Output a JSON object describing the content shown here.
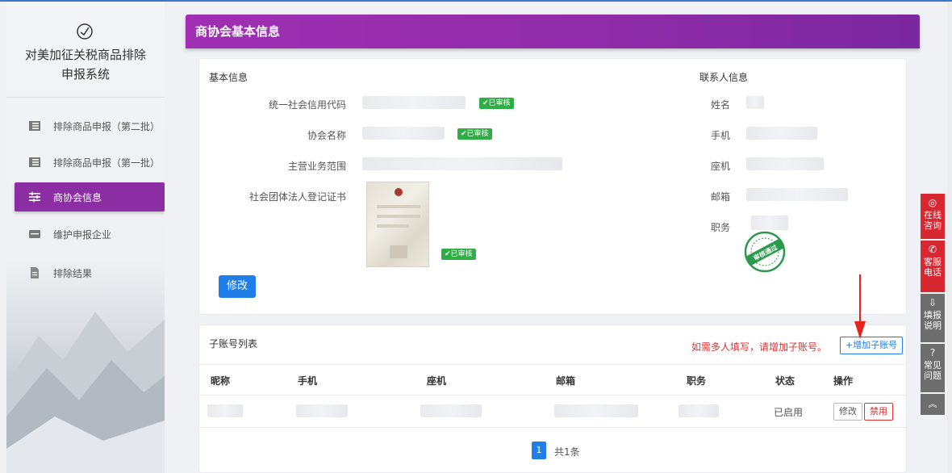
{
  "sidebar": {
    "title_line1": "对美加征关税商品排除",
    "title_line2": "申报系统",
    "items": [
      {
        "label": "排除商品申报（第二批）",
        "icon": "list-icon"
      },
      {
        "label": "排除商品申报（第一批）",
        "icon": "list-icon"
      },
      {
        "label": "商协会信息",
        "icon": "sliders-icon",
        "active": true
      },
      {
        "label": "维护申报企业",
        "icon": "inbox-icon"
      },
      {
        "label": "排除结果",
        "icon": "document-icon"
      }
    ]
  },
  "header": {
    "title": "商协会基本信息"
  },
  "basic": {
    "title": "基本信息",
    "credit_code_label": "统一社会信用代码",
    "assoc_name_label": "协会名称",
    "business_scope_label": "主营业务范围",
    "certificate_label": "社会团体法人登记证书",
    "verified_badge": "✔已审核",
    "edit_button": "修改"
  },
  "contact": {
    "title": "联系人信息",
    "name_label": "姓名",
    "mobile_label": "手机",
    "landline_label": "座机",
    "email_label": "邮箱",
    "position_label": "职务",
    "stamp_text": "审核通过"
  },
  "subaccounts": {
    "title": "子账号列表",
    "hint": "如需多人填写，请增加子账号。",
    "add_button": "+增加子账号",
    "columns": [
      "昵称",
      "手机",
      "座机",
      "邮箱",
      "职务",
      "状态",
      "操作"
    ],
    "rows": [
      {
        "status": "已启用",
        "edit": "修改",
        "disable": "禁用"
      }
    ],
    "pagination": {
      "current": "1",
      "total": "共1条"
    }
  },
  "right_toolbar": [
    {
      "label_line1": "在线",
      "label_line2": "咨询",
      "icon": "chat-icon",
      "color": "#d72832"
    },
    {
      "label_line1": "客服",
      "label_line2": "电话",
      "icon": "phone-icon",
      "color": "#d72832"
    },
    {
      "label_line1": "填报",
      "label_line2": "说明",
      "icon": "download-doc-icon",
      "color": "#6d6d6d"
    },
    {
      "label_line1": "常见",
      "label_line2": "问题",
      "icon": "question-icon",
      "color": "#6d6d6d"
    }
  ],
  "colors": {
    "brand_purple": "#8b2ea3",
    "primary_blue": "#1f7ee8",
    "verified_green": "#2fae46",
    "alert_red": "#e0322f"
  }
}
